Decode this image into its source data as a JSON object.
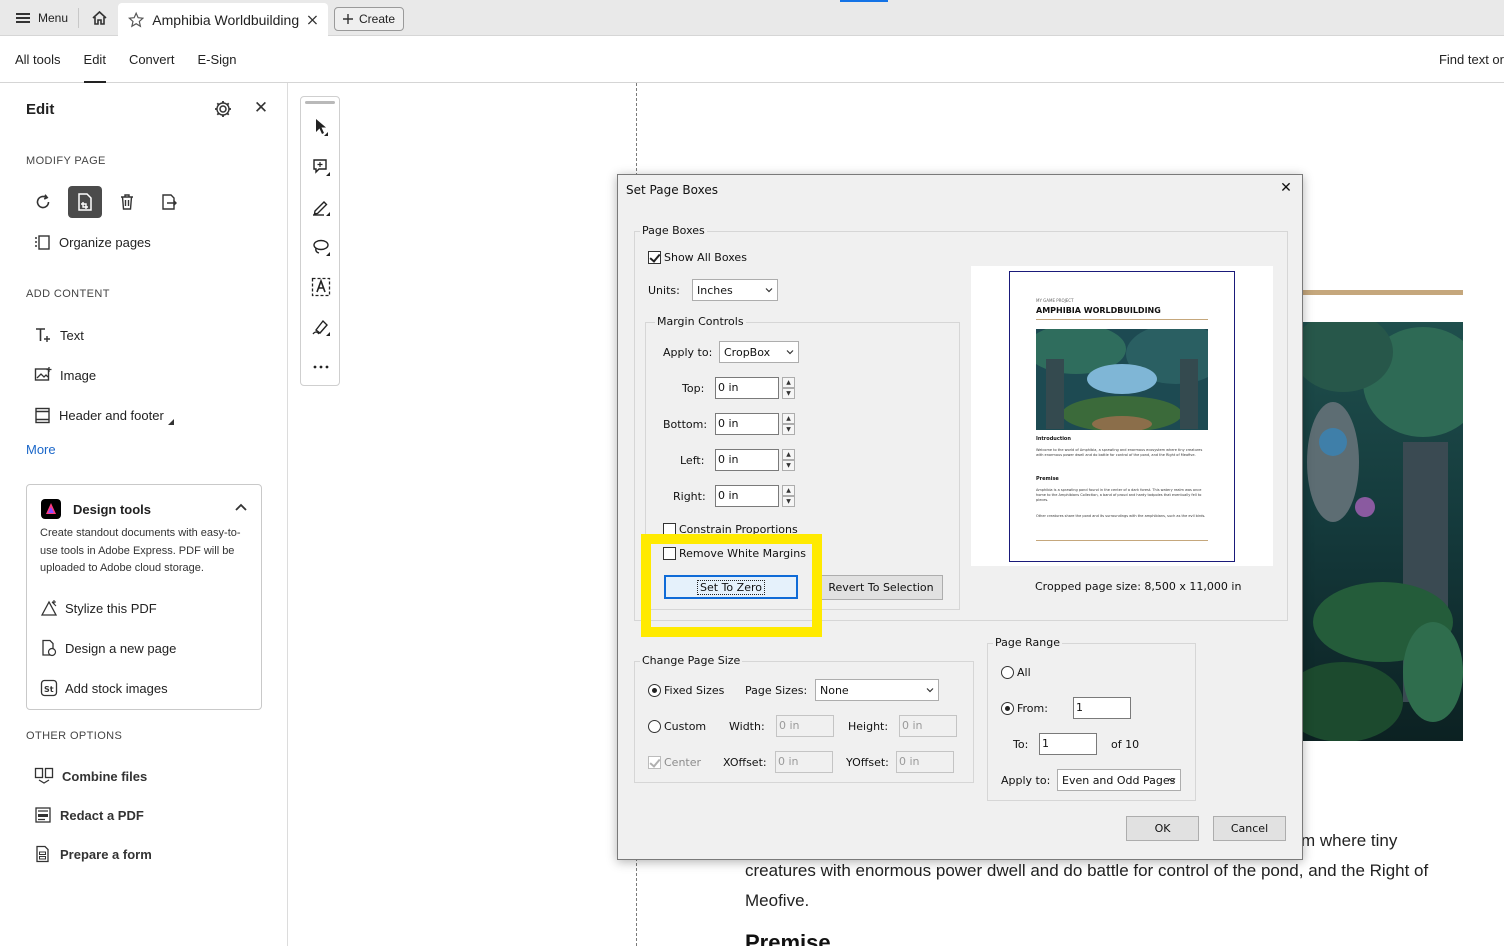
{
  "tabbar": {
    "menu_label": "Menu",
    "doc_title": "Amphibia Worldbuilding",
    "create_label": "Create"
  },
  "toolbar": {
    "tabs": [
      "All tools",
      "Edit",
      "Convert",
      "E-Sign"
    ],
    "active_tab": "Edit",
    "find_text": "Find text or"
  },
  "panel": {
    "title": "Edit",
    "modify_heading": "MODIFY PAGE",
    "organize_label": "Organize pages",
    "add_heading": "ADD CONTENT",
    "text_label": "Text",
    "image_label": "Image",
    "header_footer_label": "Header and footer",
    "more_label": "More",
    "design": {
      "title": "Design tools",
      "description": "Create standout documents with easy-to-use tools in Adobe Express. PDF will be uploaded to Adobe cloud storage.",
      "items": [
        "Stylize this PDF",
        "Design a new page",
        "Add stock images"
      ]
    },
    "other_heading": "OTHER OPTIONS",
    "other_items": [
      "Combine files",
      "Redact a PDF",
      "Prepare a form"
    ]
  },
  "document": {
    "text_partial": "m where tiny",
    "text_rest": "creatures with enormous power dwell and do battle for control of the pond, and the Right of Meofive.",
    "heading_partial": "Premise"
  },
  "dialog": {
    "title": "Set Page Boxes",
    "page_boxes_label": "Page Boxes",
    "show_all_boxes": "Show All Boxes",
    "show_all_checked": true,
    "units_label": "Units:",
    "units_value": "Inches",
    "margin_controls_label": "Margin Controls",
    "apply_to_label": "Apply to:",
    "apply_to_value": "CropBox",
    "top_label": "Top:",
    "top_value": "0 in",
    "bottom_label": "Bottom:",
    "bottom_value": "0 in",
    "left_label": "Left:",
    "left_value": "0 in",
    "right_label": "Right:",
    "right_value": "0 in",
    "constrain_label": "Constrain Proportions",
    "remove_white_label": "Remove White Margins",
    "set_to_zero_label": "Set To Zero",
    "revert_label": "Revert To Selection",
    "cropped_size": "Cropped page size: 8,500 x 11,000 in",
    "change_page_size_label": "Change Page Size",
    "fixed_sizes_label": "Fixed Sizes",
    "page_sizes_label": "Page Sizes:",
    "page_sizes_value": "None",
    "custom_label": "Custom",
    "width_label": "Width:",
    "width_value": "0 in",
    "height_label": "Height:",
    "height_value": "0 in",
    "center_label": "Center",
    "xoffset_label": "XOffset:",
    "xoffset_value": "0 in",
    "yoffset_label": "YOffset:",
    "yoffset_value": "0 in",
    "page_range_label": "Page Range",
    "all_label": "All",
    "from_label": "From:",
    "from_value": "1",
    "to_label": "To:",
    "to_value": "1",
    "of_label": "of 10",
    "range_apply_label": "Apply to:",
    "range_apply_value": "Even and Odd Pages",
    "ok_label": "OK",
    "cancel_label": "Cancel",
    "preview": {
      "kicker": "MY GAME PROJECT",
      "heading": "AMPHIBIA WORLDBUILDING",
      "intro_heading": "Introduction",
      "intro_text": "Welcome to the world of Amphibia, a sprawling and enormous ecosystem where tiny creatures with enormous power dwell and do battle for control of the pond, and the Right of Meofive.",
      "premise_heading": "Premise",
      "premise_text": "Amphibia is a sprawling pond found in the center of a dark forest. This watery realm was once home to the Amphibians Collection, a band of proud and hardy tadpoles that eventually fell to pieces.",
      "other_text": "Other creatures share the pond and its surroundings with the amphibians, such as the evil birds."
    }
  },
  "colors": {
    "accent": "#1473e6",
    "highlight": "#ffea00",
    "focus_border": "#0f6bd7",
    "gold_rule": "#c5a77c"
  }
}
